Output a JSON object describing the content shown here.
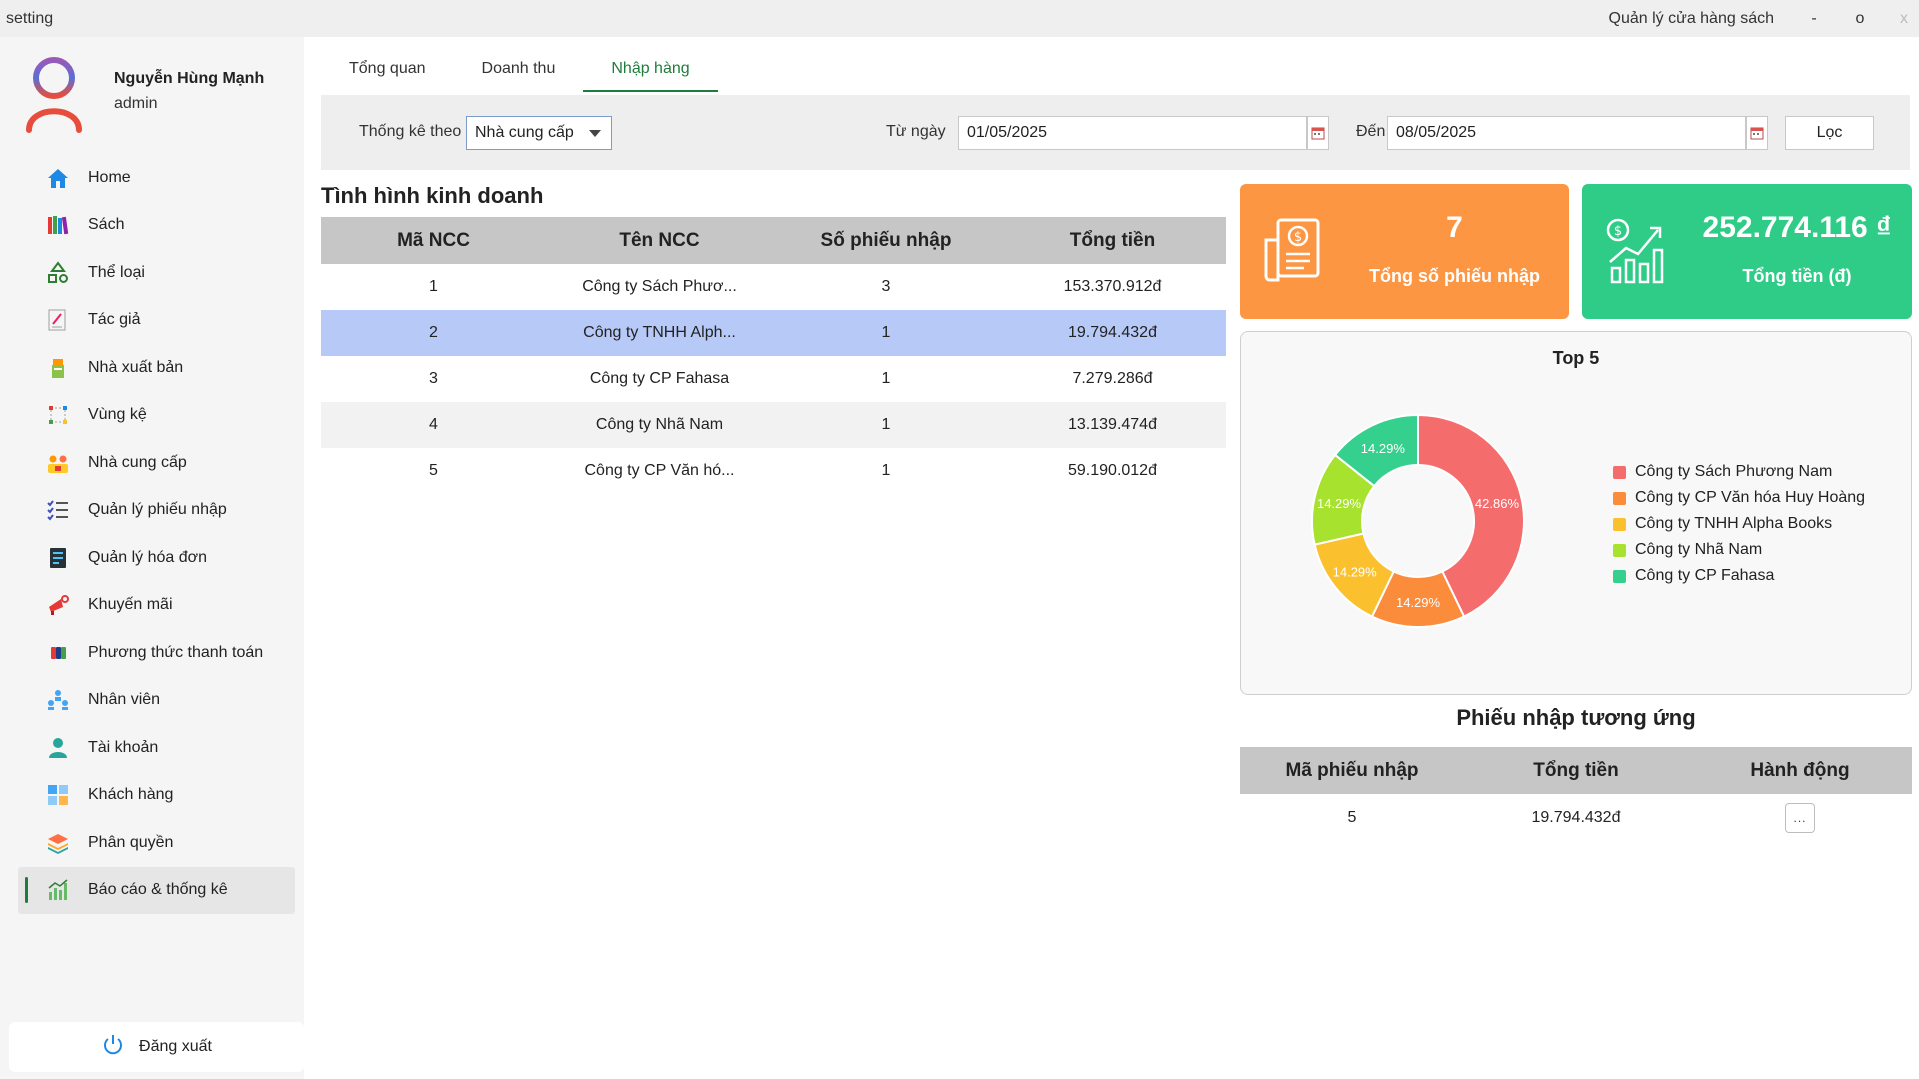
{
  "titlebar": {
    "left_label": "setting",
    "app_title": "Quản lý cửa hàng sách",
    "minimize": "-",
    "maximize": "o",
    "close": "x"
  },
  "user": {
    "name": "Nguyễn Hùng Mạnh",
    "role": "admin"
  },
  "sidebar": {
    "items": [
      {
        "label": "Home",
        "icon": "home-icon"
      },
      {
        "label": "Sách",
        "icon": "books-icon"
      },
      {
        "label": "Thể loại",
        "icon": "shapes-icon"
      },
      {
        "label": "Tác giả",
        "icon": "author-icon"
      },
      {
        "label": "Nhà xuất bản",
        "icon": "publisher-icon"
      },
      {
        "label": "Vùng kệ",
        "icon": "shelf-area-icon"
      },
      {
        "label": "Nhà cung cấp",
        "icon": "supplier-icon"
      },
      {
        "label": "Quản lý phiếu nhập",
        "icon": "checklist-icon"
      },
      {
        "label": "Quản lý hóa đơn",
        "icon": "invoice-icon"
      },
      {
        "label": "Khuyến mãi",
        "icon": "megaphone-icon"
      },
      {
        "label": "Phương thức thanh toán",
        "icon": "payment-icon"
      },
      {
        "label": "Nhân viên",
        "icon": "staff-icon"
      },
      {
        "label": "Tài khoản",
        "icon": "account-icon"
      },
      {
        "label": "Khách hàng",
        "icon": "customer-icon"
      },
      {
        "label": "Phân quyền",
        "icon": "layers-icon"
      },
      {
        "label": "Báo cáo & thống kê",
        "icon": "report-chart-icon",
        "active": true
      }
    ],
    "logout_label": "Đăng xuất"
  },
  "tabs": [
    "Tổng quan",
    "Doanh thu",
    "Nhập hàng"
  ],
  "filter": {
    "group_label": "Thống kê theo",
    "group_value": "Nhà cung cấp",
    "from_label": "Từ ngày",
    "from_value": "01/05/2025",
    "to_label": "Đến",
    "to_value": "08/05/2025",
    "filter_button": "Lọc"
  },
  "business": {
    "title": "Tình hình kinh doanh",
    "columns": [
      "Mã NCC",
      "Tên NCC",
      "Số phiếu nhập",
      "Tổng tiền"
    ],
    "rows": [
      [
        "1",
        "Công ty Sách Phươ...",
        "3",
        "153.370.912đ"
      ],
      [
        "2",
        "Công ty TNHH Alph...",
        "1",
        "19.794.432đ"
      ],
      [
        "3",
        "Công ty CP Fahasa",
        "1",
        "7.279.286đ"
      ],
      [
        "4",
        "Công ty Nhã Nam",
        "1",
        "13.139.474đ"
      ],
      [
        "5",
        "Công ty CP Văn hó...",
        "1",
        "59.190.012đ"
      ]
    ],
    "selected_row": 1
  },
  "cards": {
    "count_value": "7",
    "count_caption": "Tổng số phiếu nhập",
    "total_value": "252.774.116 ₫",
    "total_caption": "Tổng tiền (đ)",
    "count_color": "#fc9642",
    "total_color": "#2ecc87"
  },
  "chart_data": {
    "type": "pie",
    "title": "Top 5",
    "donut": true,
    "labels": [
      "Công ty Sách Phương Nam",
      "Công ty CP Văn hóa Huy Hoàng",
      "Công ty TNHH Alpha Books",
      "Công ty Nhã Nam",
      "Công ty CP Fahasa"
    ],
    "values": [
      42.86,
      14.29,
      14.29,
      14.29,
      14.29
    ],
    "value_labels": [
      "42.86%",
      "14.29%",
      "14.29%",
      "14.29%",
      "14.29%"
    ],
    "colors": [
      "#f56c6c",
      "#fb8c3c",
      "#fbc02d",
      "#a6e22e",
      "#35d08e"
    ],
    "legend_position": "right"
  },
  "receipts": {
    "title": "Phiếu nhập tương ứng",
    "columns": [
      "Mã phiếu nhập",
      "Tổng tiền",
      "Hành động"
    ],
    "rows": [
      {
        "id": "5",
        "total": "19.794.432đ",
        "action": "..."
      }
    ]
  }
}
